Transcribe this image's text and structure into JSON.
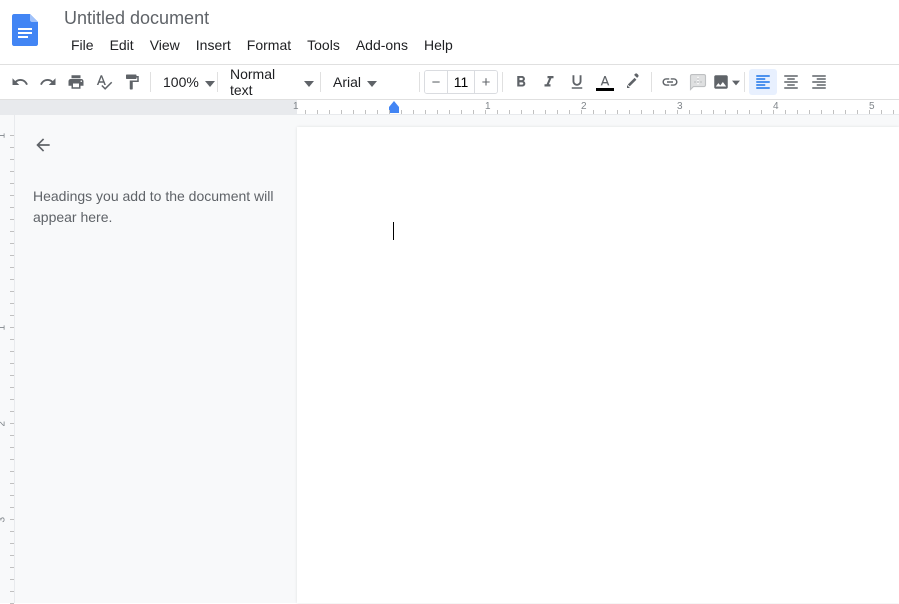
{
  "doc": {
    "title": "Untitled document"
  },
  "menu": {
    "items": [
      "File",
      "Edit",
      "View",
      "Insert",
      "Format",
      "Tools",
      "Add-ons",
      "Help"
    ]
  },
  "toolbar": {
    "zoom": "100%",
    "style": "Normal text",
    "font": "Arial",
    "size": "11"
  },
  "outline": {
    "placeholder": "Headings you add to the document will appear here."
  },
  "ruler": {
    "numbers": [
      "1",
      "1",
      "2",
      "3",
      "4",
      "5"
    ]
  },
  "vruler": {
    "numbers": [
      "1",
      "1",
      "2",
      "3"
    ]
  },
  "colors": {
    "accent": "#1a73e8",
    "text_underline": "#000000"
  }
}
